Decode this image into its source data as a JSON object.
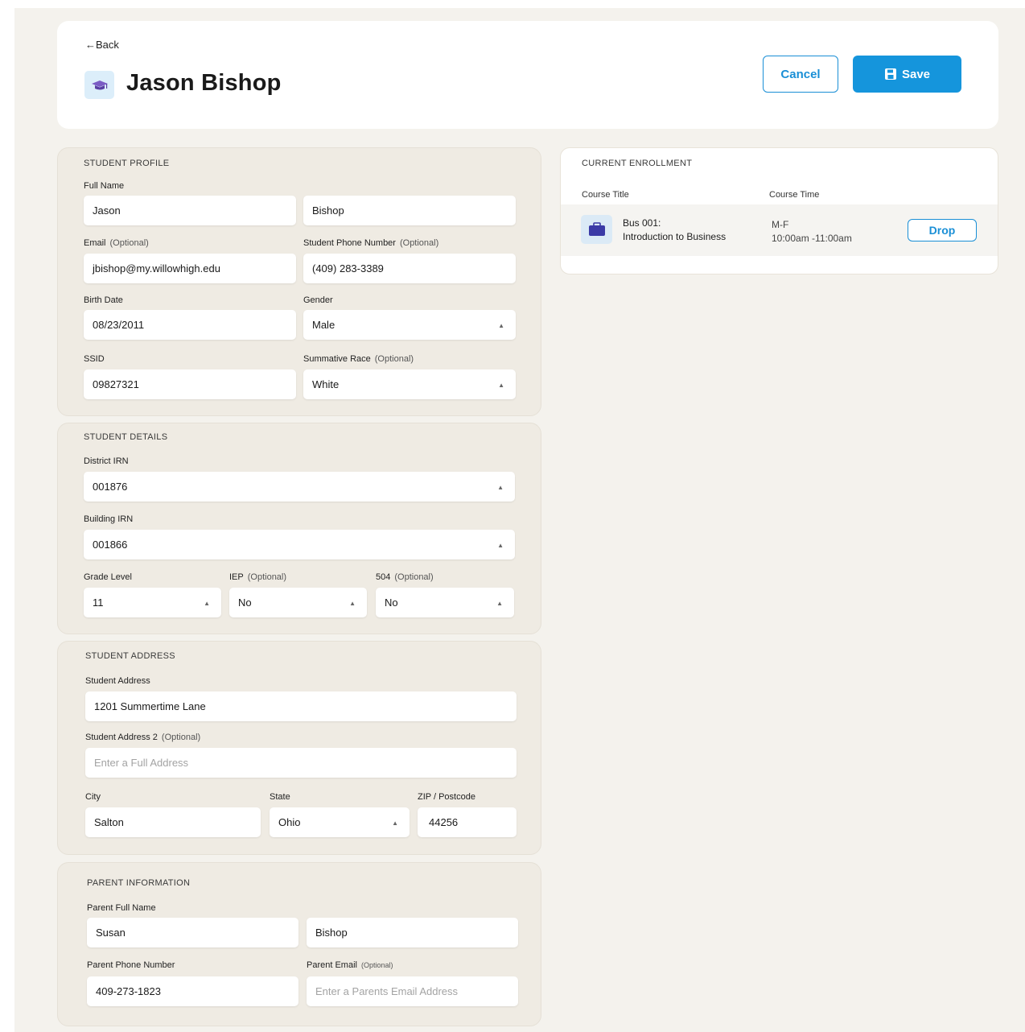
{
  "header": {
    "back_label": "←Back",
    "title": "Jason Bishop",
    "cancel_label": "Cancel",
    "save_label": "Save"
  },
  "student_profile": {
    "section_title": "STUDENT PROFILE",
    "full_name_label": "Full Name",
    "first_name": "Jason",
    "last_name": "Bishop",
    "email_label": "Email",
    "email_optional": "(Optional)",
    "email": "jbishop@my.willowhigh.edu",
    "phone_label": "Student Phone Number",
    "phone_optional": "(Optional)",
    "phone": "(409) 283-3389",
    "birth_date_label": "Birth Date",
    "birth_date": "08/23/2011",
    "gender_label": "Gender",
    "gender": "Male",
    "ssid_label": "SSID",
    "ssid": "09827321",
    "race_label": "Summative Race",
    "race_optional": "(Optional)",
    "race": "White"
  },
  "student_details": {
    "section_title": "STUDENT DETAILS",
    "district_irn_label": "District IRN",
    "district_irn": "001876",
    "building_irn_label": "Building IRN",
    "building_irn": "001866",
    "grade_label": "Grade Level",
    "grade": "11",
    "iep_label": "IEP",
    "iep_optional": "(Optional)",
    "iep": "No",
    "s504_label": "504",
    "s504_optional": "(Optional)",
    "s504": "No"
  },
  "student_address": {
    "section_title": "STUDENT ADDRESS",
    "address_label": "Student Address",
    "address": "1201 Summertime Lane",
    "address2_label": "Student Address 2",
    "address2_optional": "(Optional)",
    "address2_placeholder": "Enter a Full Address",
    "city_label": "City",
    "city": "Salton",
    "state_label": "State",
    "state": "Ohio",
    "zip_label": "ZIP / Postcode",
    "zip": "44256"
  },
  "parent_information": {
    "section_title": "PARENT INFORMATION",
    "full_name_label": "Parent Full Name",
    "first_name": "Susan",
    "last_name": "Bishop",
    "phone_label": "Parent Phone Number",
    "phone": "409-273-1823",
    "email_label": "Parent Email",
    "email_optional": "(Optional)",
    "email_placeholder": "Enter a Parents Email Address"
  },
  "enrollment": {
    "section_title": "CURRENT ENROLLMENT",
    "col_course_title": "Course Title",
    "col_course_time": "Course Time",
    "course_code": "Bus 001:",
    "course_name": "Introduction to Business",
    "course_days": "M-F",
    "course_hours": "10:00am -11:00am",
    "drop_label": "Drop"
  },
  "colors": {
    "accent": "#1595dc",
    "background": "#f4f2ed",
    "section_bg": "#efebe3"
  },
  "icons": {
    "title_icon": "graduation-cap-icon",
    "course_icon": "briefcase-icon",
    "save_icon": "floppy-disk-icon",
    "select_caret": "caret-icon"
  }
}
